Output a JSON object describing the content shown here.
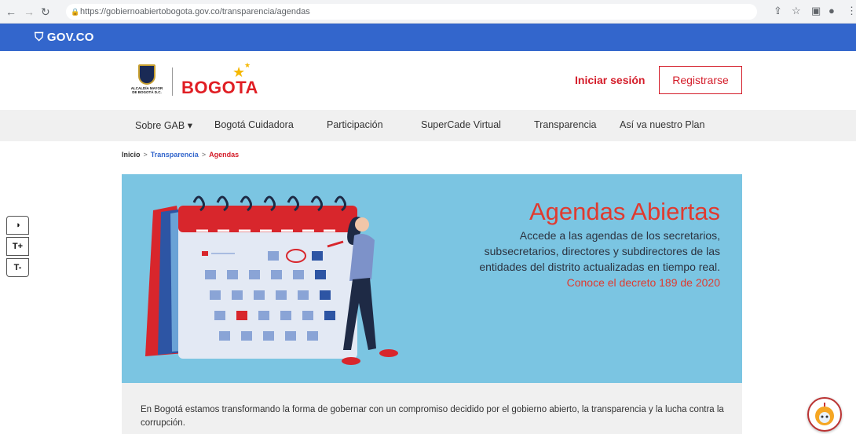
{
  "browser": {
    "url": "https://gobiernoabiertobogota.gov.co/transparencia/agendas"
  },
  "gov_bar": {
    "label": "GOV.CO"
  },
  "header": {
    "crest_text": "ALCALDÍA MAYOR DE BOGOTÁ D.C.",
    "brand": "BOGOTA",
    "login": "Iniciar sesión",
    "register": "Registrarse"
  },
  "menu": {
    "items": [
      {
        "label": "Sobre GAB ▾"
      },
      {
        "label": "Bogotá Cuidadora"
      },
      {
        "label": "Participación"
      },
      {
        "label": "SuperCade Virtual"
      },
      {
        "label": "Transparencia"
      },
      {
        "label": "Así va nuestro Plan"
      }
    ]
  },
  "breadcrumb": {
    "home": "Inicio",
    "sep": ">",
    "parent": "Transparencia",
    "current": "Agendas"
  },
  "hero": {
    "title": "Agendas Abiertas",
    "lines": [
      "Accede a las agendas de los secretarios,",
      "subsecretarios, directores y subdirectores de las",
      "entidades del distrito actualizadas en tiempo real."
    ],
    "link": "Conoce el decreto 189 de 2020"
  },
  "intro": {
    "text": "En Bogotá estamos transformando la forma de gobernar con un compromiso decidido por el gobierno abierto, la transparencia y la lucha contra la corrupción."
  },
  "accessibility": {
    "contrast": "◑",
    "increase": "T+",
    "decrease": "T-"
  },
  "colors": {
    "gov_blue": "#3366cc",
    "brand_red": "#d41d2a",
    "hero_bg": "#7bc5e2"
  },
  "icons": [
    "back-icon",
    "forward-icon",
    "reload-icon",
    "lock-icon",
    "share-icon",
    "star-icon",
    "sidebar-icon",
    "profile-icon",
    "menu-dots-icon",
    "shield-icon",
    "chat-bot-icon"
  ]
}
